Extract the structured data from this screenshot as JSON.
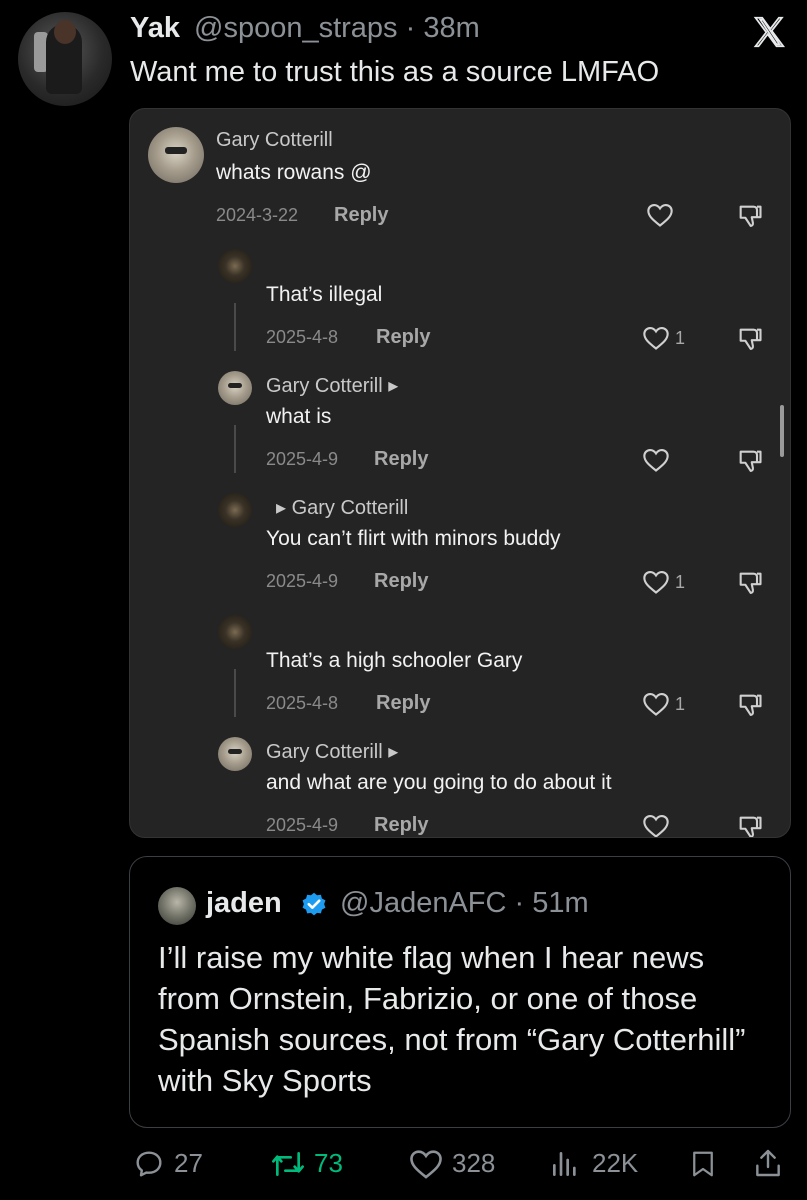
{
  "header": {
    "name": "Yak",
    "handle_time": "@spoon_straps · 38m",
    "text": "Want me to trust this as a source LMFAO"
  },
  "card": {
    "comments": [
      {
        "name": "Gary Cotterill",
        "text": "whats rowans @",
        "date": "2024-3-22",
        "reply": "Reply",
        "likes": ""
      },
      {
        "name": "",
        "text": "That’s illegal",
        "date": "2025-4-8",
        "reply": "Reply",
        "likes": "1"
      },
      {
        "name": "Gary Cotterill ▸",
        "text": "what is",
        "date": "2025-4-9",
        "reply": "Reply",
        "likes": ""
      },
      {
        "name": "▸ Gary Cotterill",
        "text": "You can’t flirt with minors buddy",
        "date": "2025-4-9",
        "reply": "Reply",
        "likes": "1"
      },
      {
        "name": "",
        "text": "That’s a high schooler Gary",
        "date": "2025-4-8",
        "reply": "Reply",
        "likes": "1"
      },
      {
        "name": "Gary Cotterill ▸",
        "text": "and what are you going to do about it",
        "date": "2025-4-9",
        "reply": "Reply",
        "likes": ""
      }
    ]
  },
  "quote": {
    "name": "jaden",
    "handle_time": "@JadenAFC · 51m",
    "text": "I’ll raise my white flag when I hear news from Ornstein, Fabrizio, or one of those Spanish sources, not from “Gary Cotterhill” with Sky Sports"
  },
  "actions": {
    "replies": "27",
    "reposts": "73",
    "likes": "328",
    "views": "22K"
  },
  "colors": {
    "background": "#000000",
    "repost_green": "#00ba7c",
    "verified_blue": "#1d9bf0",
    "secondary_text": "#8b9196"
  }
}
